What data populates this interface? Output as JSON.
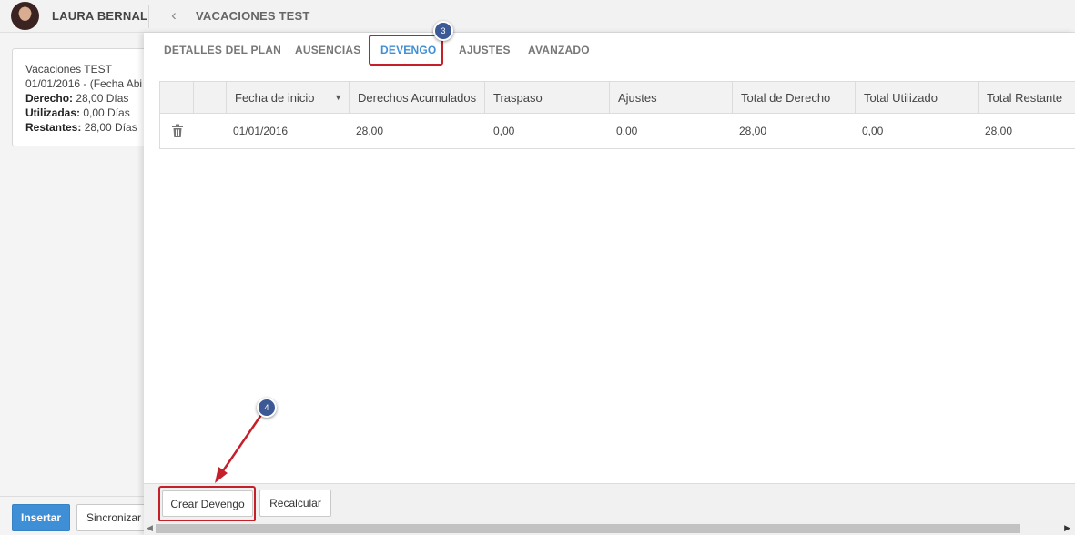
{
  "header": {
    "user_name": "LAURA BERNAL",
    "page_title": "VACACIONES TEST",
    "back_icon": "chevron-left-icon"
  },
  "summary": {
    "plan_name": "Vacaciones TEST",
    "period": "01/01/2016 - (Fecha Abi",
    "derecho_label": "Derecho:",
    "derecho_value": " 28,00 Días",
    "utilizadas_label": "Utilizadas:",
    "utilizadas_value": " 0,00 Días",
    "restantes_label": "Restantes:",
    "restantes_value": " 28,00 Días"
  },
  "left_footer": {
    "insert_label": "Insertar",
    "sync_label": "Sincronizar"
  },
  "tabs": [
    {
      "label": "DETALLES DEL PLAN",
      "active": false
    },
    {
      "label": "AUSENCIAS",
      "active": false
    },
    {
      "label": "DEVENGO",
      "active": true
    },
    {
      "label": "AJUSTES",
      "active": false
    },
    {
      "label": "AVANZADO",
      "active": false
    }
  ],
  "steps": {
    "tab_step": "3",
    "button_step": "4"
  },
  "table": {
    "columns": [
      "Fecha de inicio",
      "Derechos Acumulados",
      "Traspaso",
      "Ajustes",
      "Total de Derecho",
      "Total Utilizado",
      "Total Restante"
    ],
    "sort_icon": "sort-desc-icon",
    "rows": [
      {
        "fecha": "01/01/2016",
        "derechos": "28,00",
        "traspaso": "0,00",
        "ajustes": "0,00",
        "total_derecho": "28,00",
        "total_utilizado": "0,00",
        "total_restante": "28,00"
      }
    ]
  },
  "footer": {
    "create_label": "Crear Devengo",
    "recalc_label": "Recalcular"
  },
  "colors": {
    "accent": "#3f8fd6",
    "highlight": "#c51f2a",
    "badge": "#3c5996"
  }
}
